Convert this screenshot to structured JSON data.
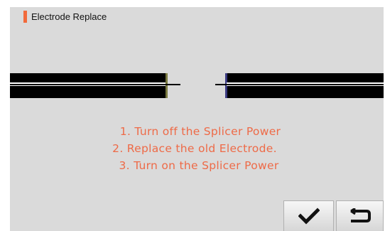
{
  "header": {
    "title": "Electrode Replace",
    "accent_color": "#f26a3b"
  },
  "instructions": {
    "color": "#ee6a47",
    "lines": [
      "1. Turn off the Splicer Power",
      "2. Replace the old Electrode.",
      "3. Turn on the Splicer Power"
    ]
  },
  "buttons": {
    "confirm": {
      "icon": "checkmark-icon"
    },
    "back": {
      "icon": "return-arrow-icon"
    }
  },
  "colors": {
    "screen_bg": "#dadada",
    "fiber": "#000000",
    "core": "#ffffff"
  }
}
